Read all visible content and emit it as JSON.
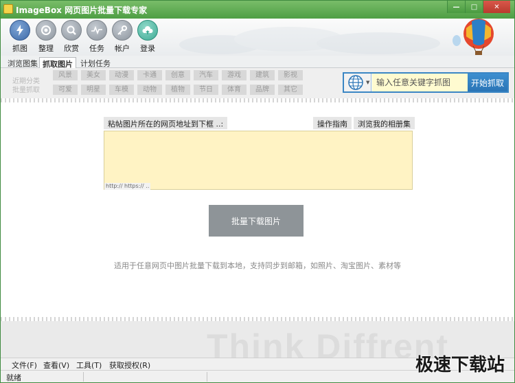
{
  "window": {
    "title": "ImageBox 网页图片批量下载专家",
    "controls": [
      "minimize-icon",
      "maximize-icon",
      "close-icon"
    ]
  },
  "toolbar": {
    "items": [
      {
        "label": "抓图",
        "icon": "lightning-icon",
        "active": true
      },
      {
        "label": "整理",
        "icon": "eye-icon"
      },
      {
        "label": "欣赏",
        "icon": "magnifier-icon"
      },
      {
        "label": "任务",
        "icon": "pulse-icon"
      },
      {
        "label": "帐户",
        "icon": "key-icon"
      },
      {
        "label": "登录",
        "icon": "cloud-upload-icon"
      }
    ]
  },
  "tabs": [
    {
      "label": "浏览图集"
    },
    {
      "label": "抓取图片",
      "active": true
    },
    {
      "label": "计划任务"
    }
  ],
  "categories": {
    "side_labels": [
      "近期分类",
      "批量抓取"
    ],
    "row1": [
      "风景",
      "美女",
      "动漫",
      "卡通",
      "创意",
      "汽车",
      "游戏",
      "建筑",
      "影视"
    ],
    "row2": [
      "可爱",
      "明星",
      "车模",
      "动物",
      "植物",
      "节日",
      "体育",
      "品牌",
      "其它"
    ]
  },
  "search": {
    "placeholder": "输入任意关键字抓图",
    "button": "开始抓取",
    "engine_icon": "globe-icon"
  },
  "main": {
    "url_label": "粘帖图片所在的网页地址到下框 ..:",
    "guide_button": "操作指南",
    "album_button": "浏览我的相册集",
    "url_hint": "http:// https:// ..",
    "download_button": "批量下载图片",
    "description": "适用于任意网页中图片批量下载到本地，支持同步到邮箱，如照片、淘宝图片、素材等",
    "banner_text": "Think Diffrent"
  },
  "menu": {
    "items": [
      "文件(F)",
      "查看(V)",
      "工具(T)",
      "获取授权(R)"
    ]
  },
  "status": {
    "text": "就绪"
  },
  "watermark": "极速下载站",
  "colors": {
    "titlebar": "#4e9e44",
    "search_border": "#3a86c4",
    "url_box": "#fff3c4"
  }
}
